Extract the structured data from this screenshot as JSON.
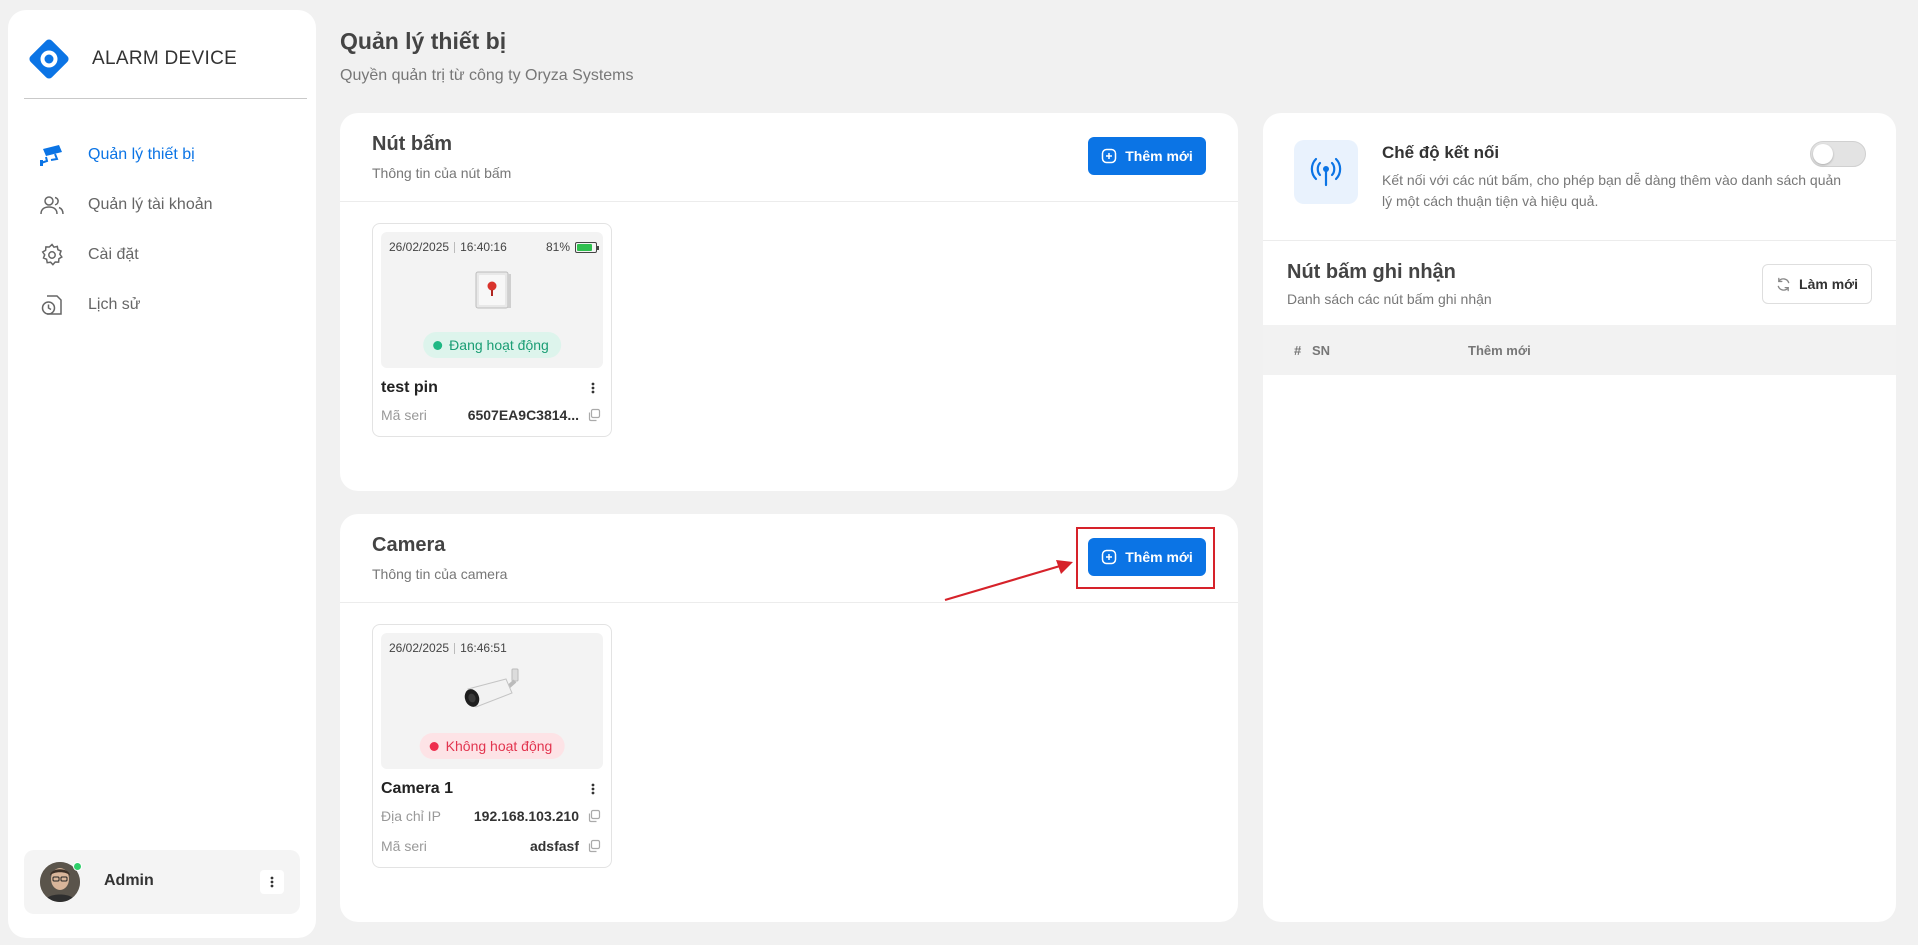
{
  "brand": {
    "name": "ALARM DEVICE"
  },
  "sidebar": {
    "items": [
      {
        "label": "Quản lý thiết bị",
        "icon": "cctv-icon",
        "active": true
      },
      {
        "label": "Quản lý tài khoản",
        "icon": "users-icon",
        "active": false
      },
      {
        "label": "Cài đặt",
        "icon": "gear-icon",
        "active": false
      },
      {
        "label": "Lịch sử",
        "icon": "history-icon",
        "active": false
      }
    ]
  },
  "user": {
    "name": "Admin",
    "online": true
  },
  "header": {
    "title": "Quản lý thiết bị",
    "subtitle": "Quyền quản trị từ công ty Oryza Systems"
  },
  "buttons_panel": {
    "title": "Nút bấm",
    "subtitle": "Thông tin của nút bấm",
    "add_label": "Thêm mới",
    "devices": [
      {
        "date": "26/02/2025",
        "time": "16:40:16",
        "battery": "81%",
        "status": "Đang hoạt động",
        "name": "test pin",
        "serial_label": "Mã seri",
        "serial": "6507EA9C3814..."
      }
    ]
  },
  "camera_panel": {
    "title": "Camera",
    "subtitle": "Thông tin của camera",
    "add_label": "Thêm mới",
    "devices": [
      {
        "date": "26/02/2025",
        "time": "16:46:51",
        "status": "Không hoạt động",
        "name": "Camera 1",
        "ip_label": "Địa chỉ IP",
        "ip": "192.168.103.210",
        "serial_label": "Mã seri",
        "serial": "adsfasf"
      }
    ]
  },
  "connection": {
    "title": "Chế độ kết nối",
    "description": "Kết nối với các nút bấm, cho phép bạn dễ dàng thêm vào danh sách quản lý một cách thuận tiện và hiệu quả.",
    "enabled": false
  },
  "recorded": {
    "title": "Nút bấm ghi nhận",
    "subtitle": "Danh sách các nút bấm ghi nhận",
    "refresh_label": "Làm mới",
    "columns": [
      "#",
      "SN",
      "Thêm mới"
    ],
    "rows": []
  },
  "colors": {
    "primary": "#0b74e5",
    "active_status": "#1fb884",
    "inactive_status": "#ee2d4d",
    "annotation": "#d6222a"
  }
}
